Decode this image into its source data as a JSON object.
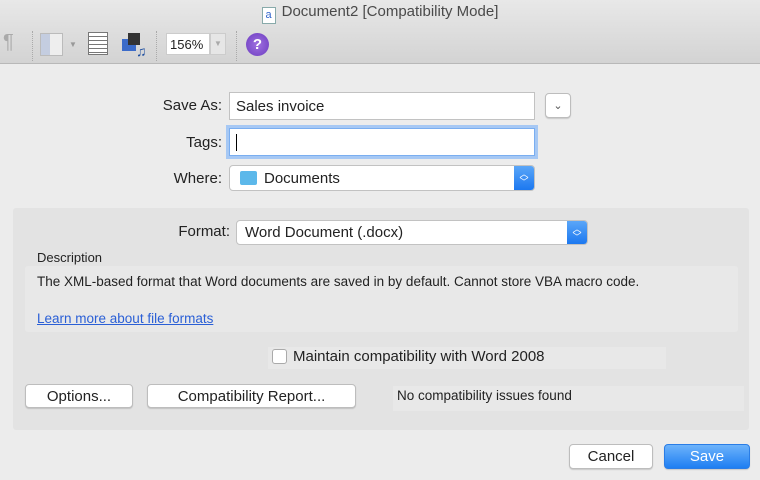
{
  "window": {
    "title": "Document2 [Compatibility Mode]"
  },
  "toolbar": {
    "zoom_value": "156%",
    "pilcrow": "¶",
    "help": "?"
  },
  "form": {
    "save_as_label": "Save As:",
    "save_as_value": "Sales invoice",
    "tags_label": "Tags:",
    "tags_value": "",
    "where_label": "Where:",
    "where_value": "Documents",
    "format_label": "Format:",
    "format_value": "Word Document (.docx)",
    "description_label": "Description",
    "description_text": "The XML-based format that Word documents are saved in by default. Cannot store VBA macro code.",
    "learn_more_link": "Learn more about file formats",
    "compat_checkbox_label": "Maintain compatibility with Word 2008",
    "compat_checked": false,
    "options_button": "Options...",
    "compat_report_button": "Compatibility Report...",
    "compat_status": "No compatibility issues found"
  },
  "buttons": {
    "cancel": "Cancel",
    "save": "Save"
  },
  "colors": {
    "accent": "#1c78f0",
    "link": "#2a5fd6"
  }
}
